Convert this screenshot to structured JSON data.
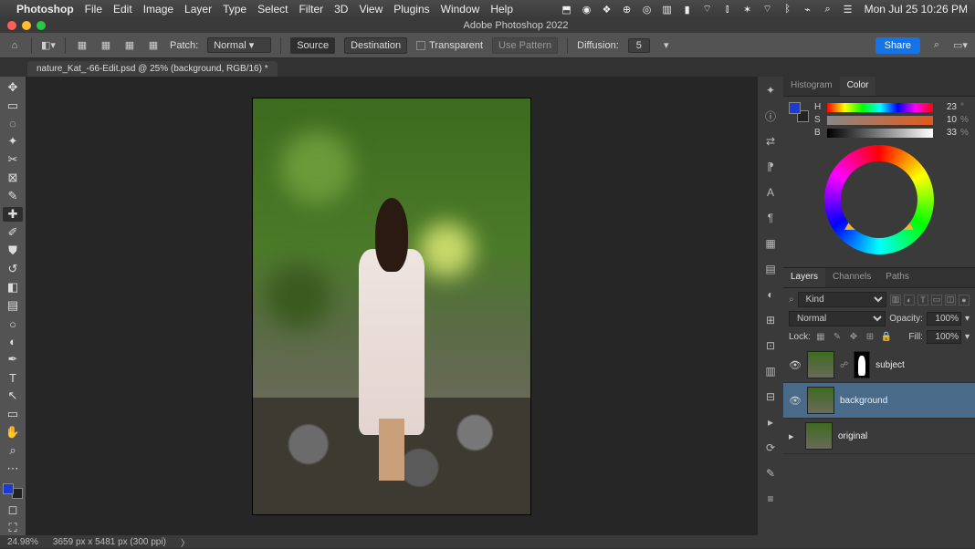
{
  "mac": {
    "app": "Photoshop",
    "menus": [
      "File",
      "Edit",
      "Image",
      "Layer",
      "Type",
      "Select",
      "Filter",
      "3D",
      "View",
      "Plugins",
      "Window",
      "Help"
    ],
    "datetime": "Mon Jul 25  10:26 PM"
  },
  "window": {
    "title": "Adobe Photoshop 2022"
  },
  "options": {
    "patch_label": "Patch:",
    "patch_mode": "Normal",
    "source": "Source",
    "destination": "Destination",
    "transparent": "Transparent",
    "use_pattern": "Use Pattern",
    "diffusion_label": "Diffusion:",
    "diffusion_value": "5",
    "share": "Share"
  },
  "doc": {
    "tab": "nature_Kat_-66-Edit.psd @ 25% (background, RGB/16) *"
  },
  "color": {
    "tab_hist": "Histogram",
    "tab_color": "Color",
    "h": "H",
    "s": "S",
    "b": "B",
    "h_val": "23",
    "s_val": "10",
    "b_val": "33",
    "pct": "%",
    "deg": "°"
  },
  "layers": {
    "tab_layers": "Layers",
    "tab_channels": "Channels",
    "tab_paths": "Paths",
    "kind_label": "Kind",
    "blend_mode": "Normal",
    "opacity_label": "Opacity:",
    "opacity_val": "100%",
    "lock_label": "Lock:",
    "fill_label": "Fill:",
    "fill_val": "100%",
    "items": [
      {
        "name": "subject",
        "has_mask": true,
        "visible": true
      },
      {
        "name": "background",
        "has_mask": false,
        "visible": true,
        "selected": true
      },
      {
        "name": "original",
        "has_mask": false,
        "visible": false,
        "group": true
      }
    ]
  },
  "status": {
    "zoom": "24.98%",
    "dims": "3659 px x 5481 px (300 ppi)",
    "arrow": "〉"
  }
}
